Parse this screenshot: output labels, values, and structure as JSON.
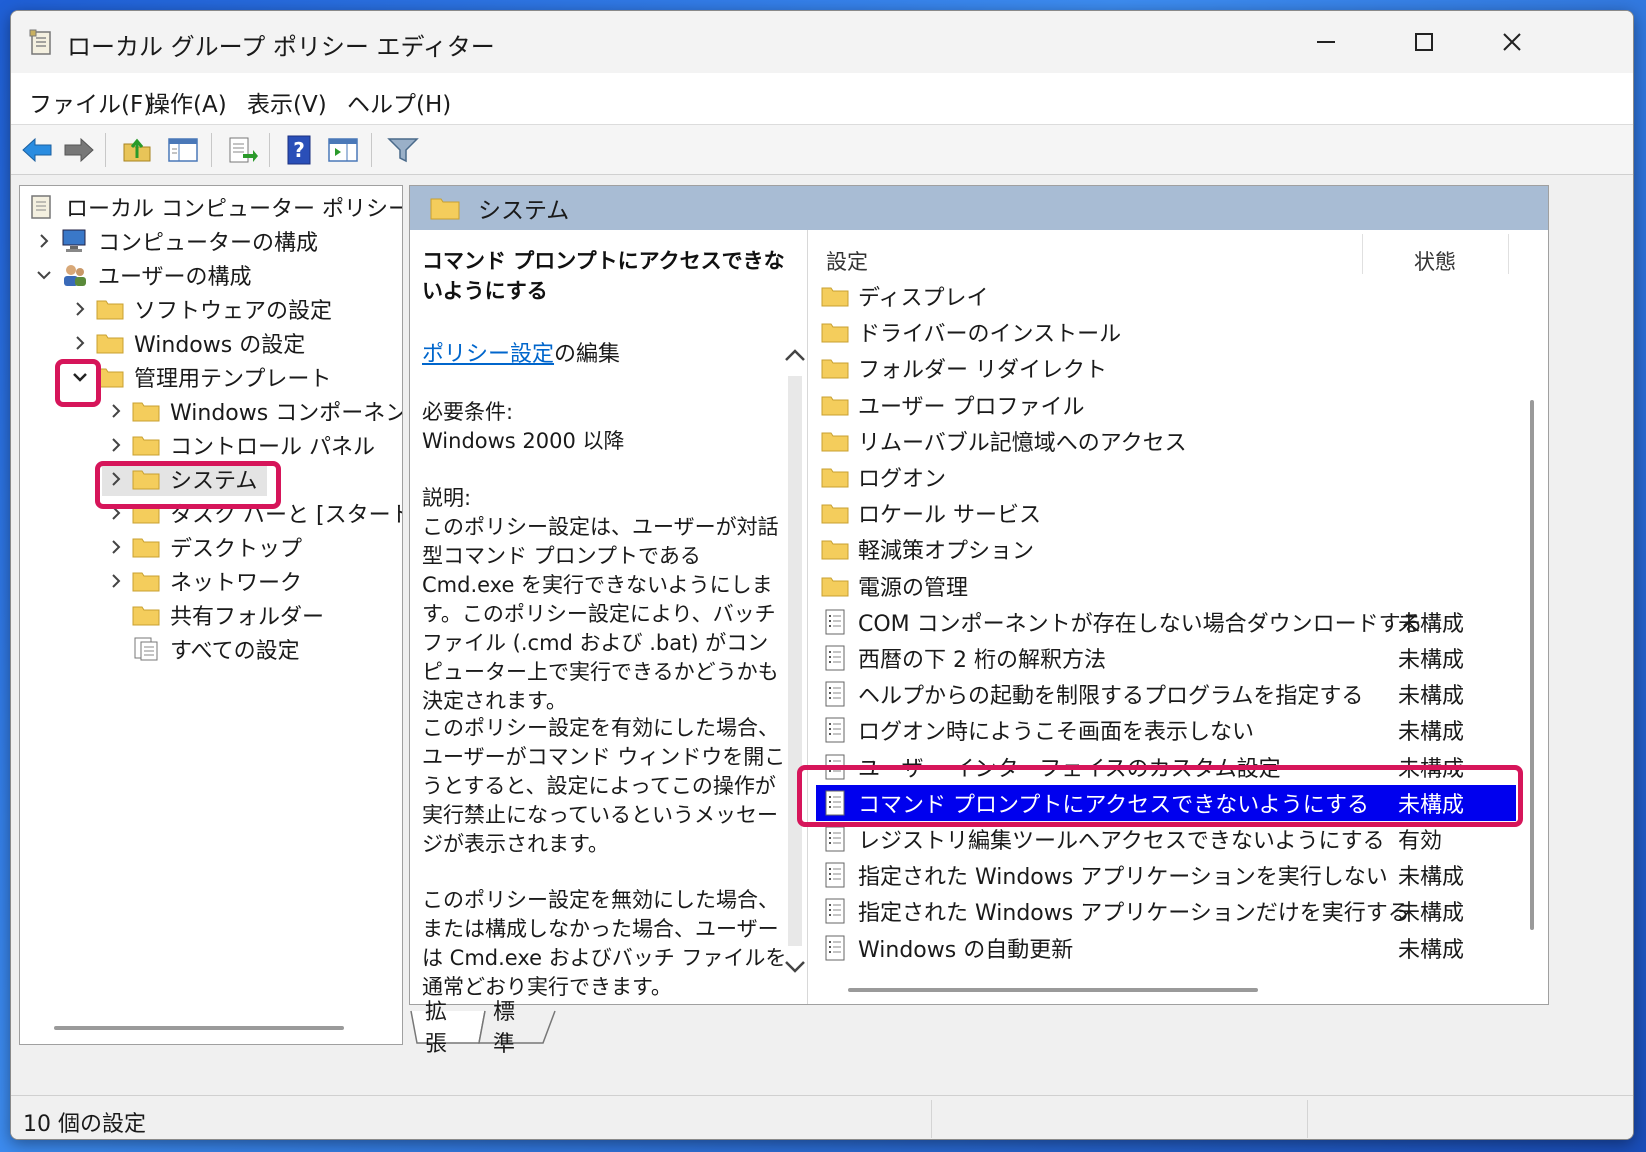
{
  "window": {
    "title": "ローカル グループ ポリシー エディター"
  },
  "menu": [
    "ファイル(F)",
    "操作(A)",
    "表示(V)",
    "ヘルプ(H)"
  ],
  "toolbar": {
    "icons": [
      "back-arrow-icon",
      "forward-arrow-icon",
      "up-folder-icon",
      "show-hide-tree-icon",
      "export-list-icon",
      "help-icon",
      "show-action-pane-icon",
      "filter-icon"
    ]
  },
  "tree": {
    "root": "ローカル コンピューター ポリシー",
    "items": [
      {
        "label": "コンピューターの構成"
      },
      {
        "label": "ユーザーの構成"
      },
      {
        "label": "ソフトウェアの設定"
      },
      {
        "label": "Windows の設定"
      },
      {
        "label": "管理用テンプレート"
      },
      {
        "label": "Windows コンポーネント"
      },
      {
        "label": "コントロール パネル"
      },
      {
        "label": "システム"
      },
      {
        "label": "タスク バーと [スタート] メニ"
      },
      {
        "label": "デスクトップ"
      },
      {
        "label": "ネットワーク"
      },
      {
        "label": "共有フォルダー"
      },
      {
        "label": "すべての設定"
      }
    ]
  },
  "pane": {
    "header": "システム",
    "description": {
      "title": "コマンド プロンプトにアクセスできないようにする",
      "link": "ポリシー設定",
      "link_suffix": "の編集",
      "requirements_label": "必要条件:",
      "requirements_value": "Windows 2000 以降",
      "explanation_label": "説明:",
      "paragraph1": "このポリシー設定は、ユーザーが対話型コマンド プロンプトである Cmd.exe を実行できないようにします。このポリシー設定により、バッチ ファイル (.cmd および .bat) がコンピューター上で実行できるかどうかも決定されます。",
      "paragraph2": "このポリシー設定を有効にした場合、ユーザーがコマンド ウィンドウを開こうとすると、設定によってこの操作が実行禁止になっているというメッセージが表示されます。",
      "paragraph3": "このポリシー設定を無効にした場合、または構成しなかった場合、ユーザーは Cmd.exe およびバッチ ファイルを通常どおり実行できます。"
    },
    "columns": {
      "setting": "設定",
      "state": "状態"
    },
    "rows": [
      {
        "name": "ディスプレイ",
        "type": "folder",
        "state": ""
      },
      {
        "name": "ドライバーのインストール",
        "type": "folder",
        "state": ""
      },
      {
        "name": "フォルダー リダイレクト",
        "type": "folder",
        "state": ""
      },
      {
        "name": "ユーザー プロファイル",
        "type": "folder",
        "state": ""
      },
      {
        "name": "リムーバブル記憶域へのアクセス",
        "type": "folder",
        "state": ""
      },
      {
        "name": "ログオン",
        "type": "folder",
        "state": ""
      },
      {
        "name": "ロケール サービス",
        "type": "folder",
        "state": ""
      },
      {
        "name": "軽減策オプション",
        "type": "folder",
        "state": ""
      },
      {
        "name": "電源の管理",
        "type": "folder",
        "state": ""
      },
      {
        "name": "COM コンポーネントが存在しない場合ダウンロードする",
        "type": "setting",
        "state": "未構成"
      },
      {
        "name": "西暦の下 2 桁の解釈方法",
        "type": "setting",
        "state": "未構成"
      },
      {
        "name": "ヘルプからの起動を制限するプログラムを指定する",
        "type": "setting",
        "state": "未構成"
      },
      {
        "name": "ログオン時にようこそ画面を表示しない",
        "type": "setting",
        "state": "未構成"
      },
      {
        "name": "ユーザー インターフェイスのカスタム設定",
        "type": "setting",
        "state": "未構成"
      },
      {
        "name": "コマンド プロンプトにアクセスできないようにする",
        "type": "setting",
        "state": "未構成",
        "selected": true
      },
      {
        "name": "レジストリ編集ツールへアクセスできないようにする",
        "type": "setting",
        "state": "有効"
      },
      {
        "name": "指定された Windows アプリケーションを実行しない",
        "type": "setting",
        "state": "未構成"
      },
      {
        "name": "指定された Windows アプリケーションだけを実行する",
        "type": "setting",
        "state": "未構成"
      },
      {
        "name": "Windows の自動更新",
        "type": "setting",
        "state": "未構成"
      }
    ]
  },
  "tabs": [
    "拡張",
    "標準"
  ],
  "status": {
    "text": "10 個の設定"
  }
}
